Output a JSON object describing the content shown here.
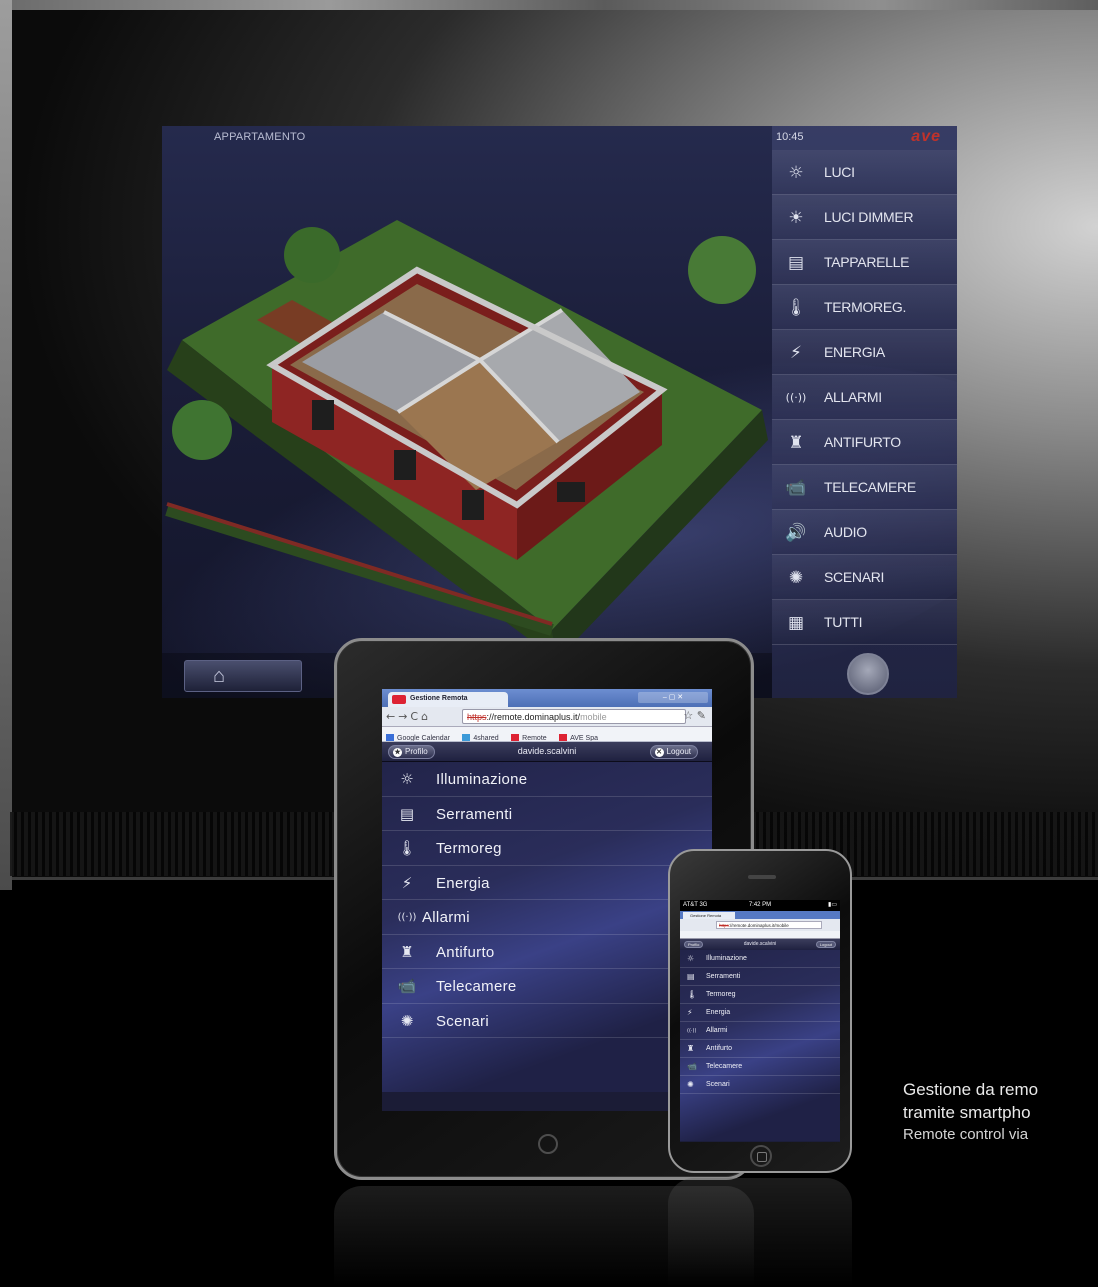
{
  "colors": {
    "brand": "#c0322b",
    "screen_bg": "#1a1d38",
    "accent_blue": "#3a4186"
  },
  "main_screen": {
    "title": "APPARTAMENTO",
    "clock": "10:45",
    "brand": "ave",
    "menu": [
      {
        "label": "LUCI",
        "icon": "bulb-icon",
        "glyph": "☼"
      },
      {
        "label": "LUCI DIMMER",
        "icon": "dimmer-icon",
        "glyph": "☀"
      },
      {
        "label": "TAPPARELLE",
        "icon": "blinds-icon",
        "glyph": "▤"
      },
      {
        "label": "TERMOREG.",
        "icon": "thermometer-icon",
        "glyph": "🌡"
      },
      {
        "label": "ENERGIA",
        "icon": "plug-icon",
        "glyph": "⚡"
      },
      {
        "label": "ALLARMI",
        "icon": "alarm-waves-icon",
        "glyph": "((·))"
      },
      {
        "label": "ANTIFURTO",
        "icon": "antitheft-icon",
        "glyph": "♜"
      },
      {
        "label": "TELECAMERE",
        "icon": "camera-icon",
        "glyph": "📹"
      },
      {
        "label": "AUDIO",
        "icon": "speaker-icon",
        "glyph": "🔊"
      },
      {
        "label": "SCENARI",
        "icon": "scenario-icon",
        "glyph": "✺"
      },
      {
        "label": "TUTTI",
        "icon": "grid-icon",
        "glyph": "▦"
      }
    ]
  },
  "tablet": {
    "browser": {
      "tab_title": "Gestione Remota",
      "url_scheme": "https",
      "url_main": "://remote.dominaplus.it/",
      "url_tail": "mobile",
      "bookmarks": [
        "Google Calendar",
        "4shared",
        "Remote",
        "AVE Spa"
      ]
    },
    "header": {
      "profile_label": "Profilo",
      "username": "davide.scalvini",
      "logout_label": "Logout"
    },
    "items": [
      {
        "label": "Illuminazione",
        "icon": "bulb-icon",
        "glyph": "☼"
      },
      {
        "label": "Serramenti",
        "icon": "blinds-icon",
        "glyph": "▤"
      },
      {
        "label": "Termoreg",
        "icon": "thermometer-icon",
        "glyph": "🌡"
      },
      {
        "label": "Energia",
        "icon": "plug-icon",
        "glyph": "⚡"
      },
      {
        "label": "Allarmi",
        "icon": "alarm-waves-icon",
        "glyph": "((·))"
      },
      {
        "label": "Antifurto",
        "icon": "antitheft-icon",
        "glyph": "♜"
      },
      {
        "label": "Telecamere",
        "icon": "camera-icon",
        "glyph": "📹"
      },
      {
        "label": "Scenari",
        "icon": "scenario-icon",
        "glyph": "✺"
      }
    ]
  },
  "phone": {
    "status": {
      "carrier": "AT&T 3G",
      "time": "7:42 PM"
    },
    "browser": {
      "tab_title": "Gestione Remota",
      "url_scheme": "https",
      "url_main": "://remote.dominaplus.it/mobile"
    },
    "header": {
      "profile_label": "Profilo",
      "username": "davide.scalvini",
      "logout_label": "Logout"
    },
    "items": [
      {
        "label": "Illuminazione",
        "glyph": "☼"
      },
      {
        "label": "Serramenti",
        "glyph": "▤"
      },
      {
        "label": "Termoreg",
        "glyph": "🌡"
      },
      {
        "label": "Energia",
        "glyph": "⚡"
      },
      {
        "label": "Allarmi",
        "glyph": "((·))"
      },
      {
        "label": "Antifurto",
        "glyph": "♜"
      },
      {
        "label": "Telecamere",
        "glyph": "📹"
      },
      {
        "label": "Scenari",
        "glyph": "✺"
      }
    ]
  },
  "caption": {
    "line1": "Gestione da remo",
    "line2": "tramite smartpho",
    "line3": "Remote control via"
  }
}
